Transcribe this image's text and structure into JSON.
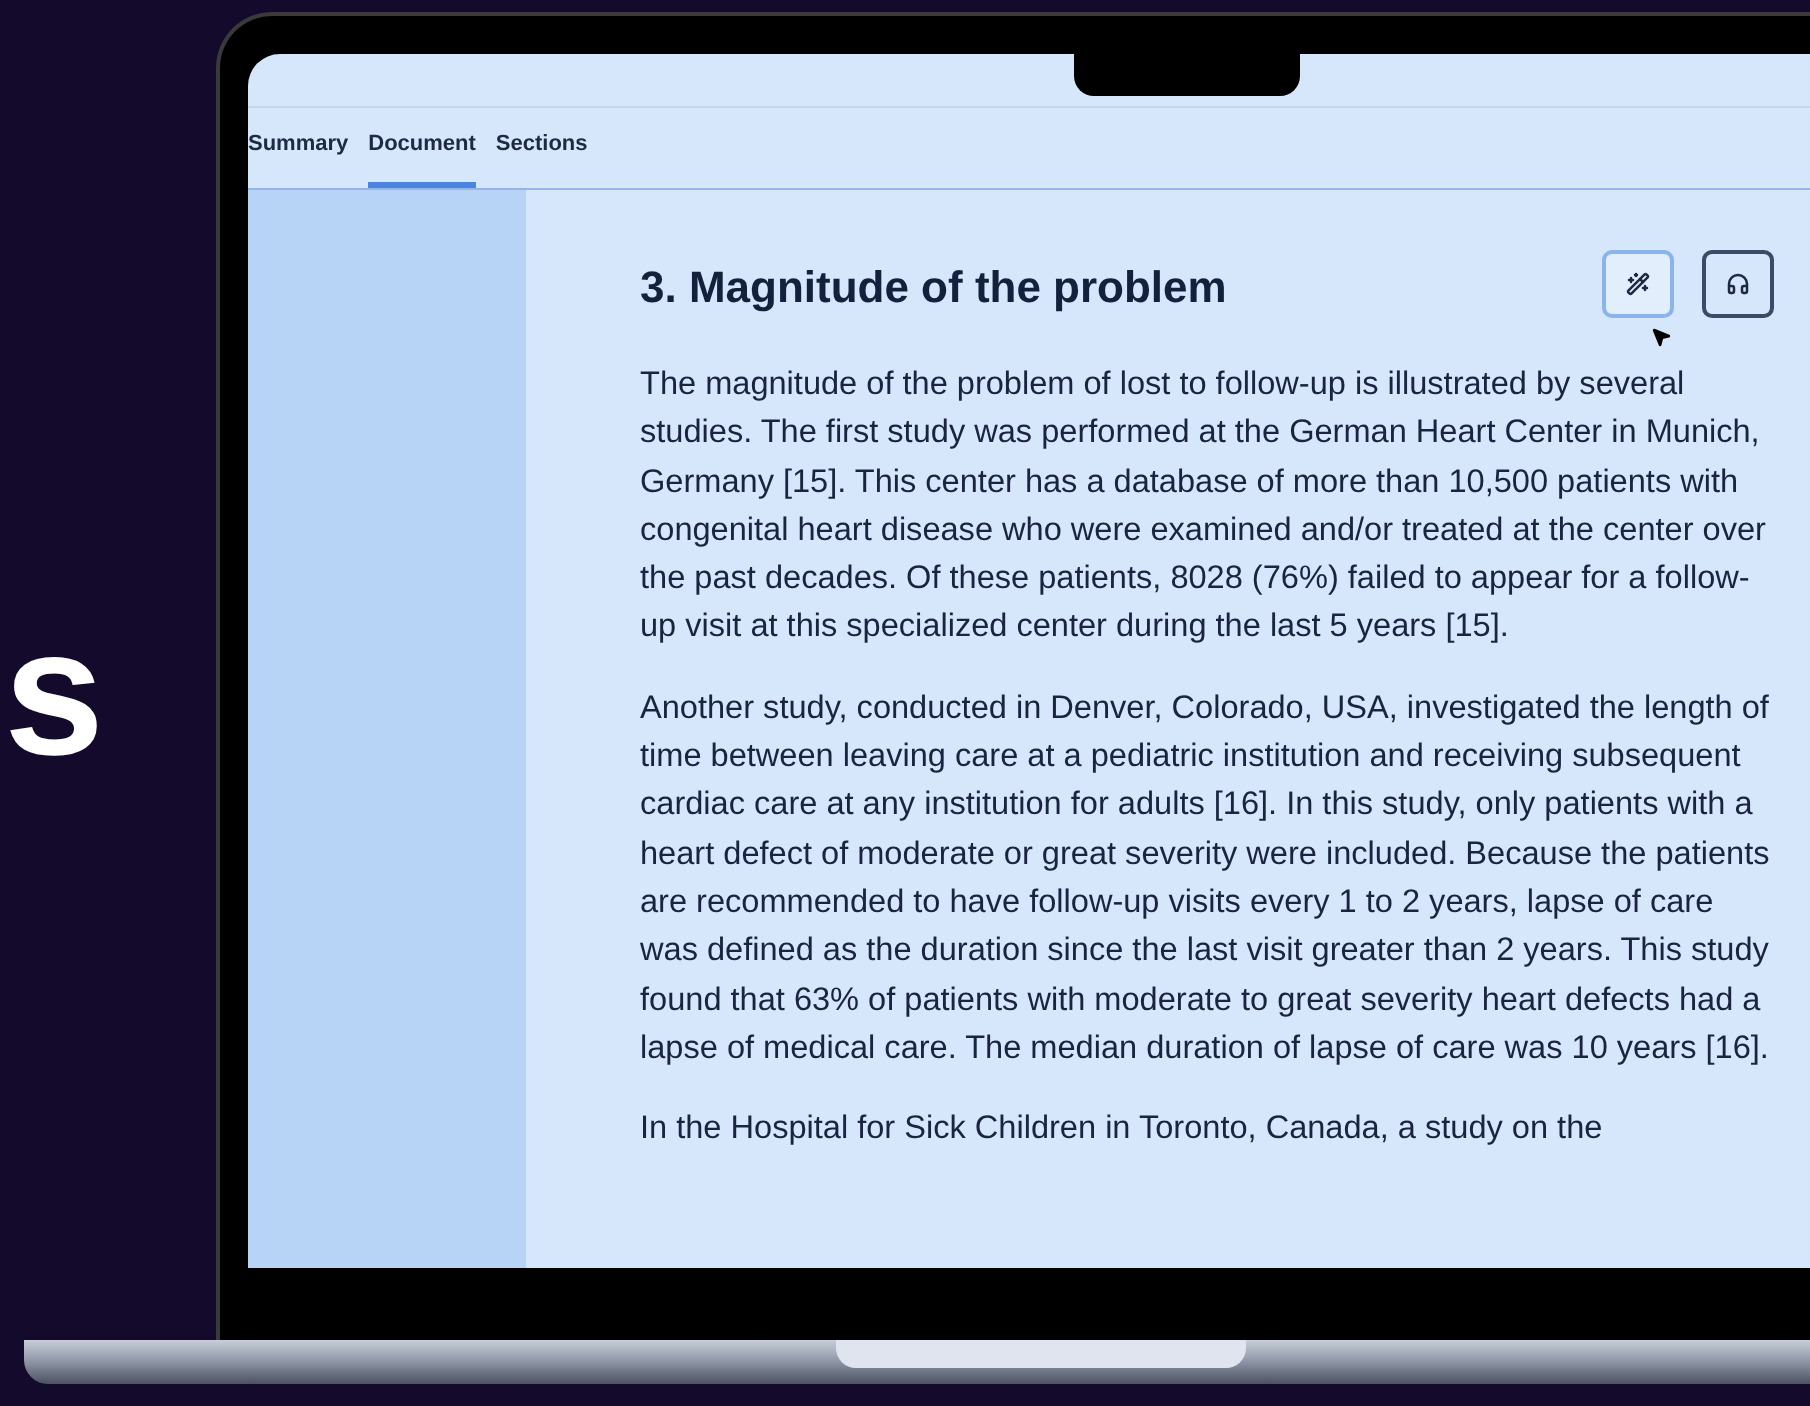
{
  "backdrop_text": "s",
  "tabs": [
    {
      "label": "Summary",
      "selected": false
    },
    {
      "label": "Document",
      "selected": true
    },
    {
      "label": "Sections",
      "selected": false
    }
  ],
  "document": {
    "heading": "3. Magnitude of the problem",
    "tool_buttons": [
      {
        "kind": "magic",
        "selected": true
      },
      {
        "kind": "audio",
        "selected": false
      }
    ],
    "paragraphs": [
      "The magnitude of the problem of lost to follow-up is illustrated by several studies. The first study was performed at the German Heart Center in Munich, Germany [15]. This center has a database of more than 10,500 patients with congenital heart disease who were examined and/or treated at the center over the past decades. Of these patients, 8028 (76%) failed to appear for a follow-up visit at this specialized center during the last 5 years [15].",
      "Another study, conducted in Denver, Colorado, USA, investigated the length of time between leaving care at a pediatric institution and receiving subsequent cardiac care at any institution for adults [16]. In this study, only patients with a heart defect of moderate or great severity were included. Because the patients are recommended to have follow-up visits every 1 to 2 years, lapse of care was defined as the duration since the last visit greater than 2 years. This study found that 63% of patients with moderate to great severity heart defects had a lapse of medical care. The median duration of lapse of care was 10 years [16].",
      "In the Hospital for Sick Children in Toronto, Canada, a study on the"
    ]
  }
}
